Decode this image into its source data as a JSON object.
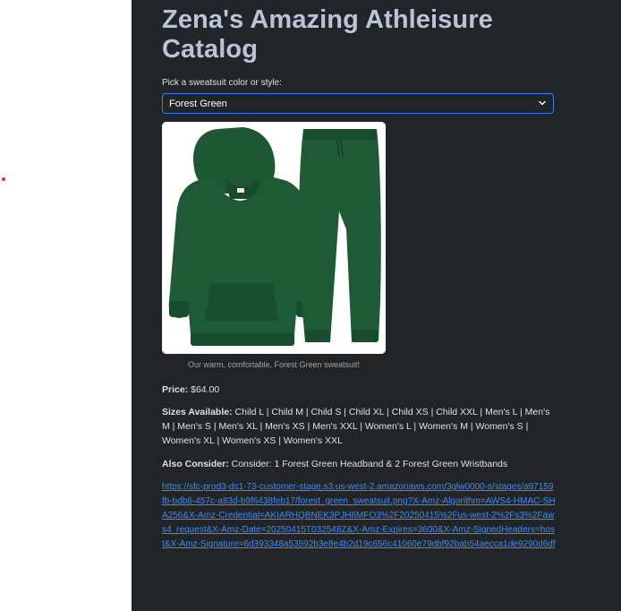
{
  "page": {
    "title": "Zena's Amazing Athleisure Catalog",
    "select_label": "Pick a sweatsuit color or style:",
    "selected_option": "Forest Green",
    "image_caption": "Our warm, comfortable, Forest Green sweatsuit!",
    "price_label": "Price:",
    "price_value": "$64.00",
    "sizes_label": "Sizes Available:",
    "sizes_value": "Child L | Child M | Child S | Child XL | Child XS | Child XXL | Men's L | Men's M | Men's S | Men's XL | Men's XS | Men's XXL | Women's L | Women's M | Women's S | Women's XL | Women's XS | Women's XXL",
    "consider_label": "Also Consider:",
    "consider_value": "Consider: 1 Forest Green Headband & 2 Forest Green Wristbands",
    "image_url": "https://sfc-prod3-ds1-73-customer-stage.s3.us-west-2.amazonaws.com/3glw0000-s/stages/a97159fb-bdb6-457c-a83d-b9f6438feb17/forest_green_sweatsuit.png?X-Amz-Algorithm=AWS4-HMAC-SHA256&X-Amz-Credential=AKIARHQBNEK3PJH6MFO3%2F20250415%2Fus-west-2%2Fs3%2Faws4_request&X-Amz-Date=20250415T032548Z&X-Amz-Expires=3600&X-Amz-SignedHeaders=host&X-Amz-Signature=6d393348a53592b3e8e4b2d19c656c41060e79dbf92bab54aecca1de9290d6df"
  },
  "colors": {
    "panel_bg": "#212529",
    "title": "#b9c5d6",
    "accent": "#3d7be8",
    "link": "#3d8bfd",
    "sweatsuit": "#1f5a36"
  },
  "icons": {
    "dropdown": "chevron-down-icon",
    "product": "sweatsuit-image"
  }
}
